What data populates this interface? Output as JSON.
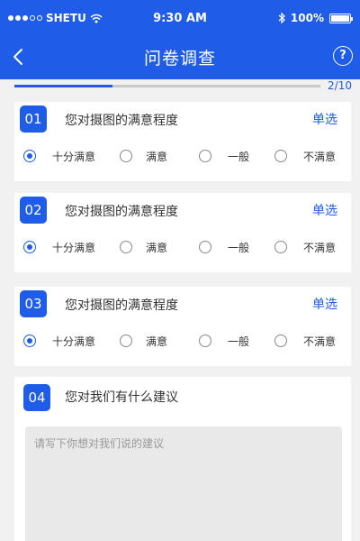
{
  "status_bar": {
    "carrier": "SHETU",
    "time": "9:30 AM",
    "battery": "100%",
    "signal_icon": "signal-dots-icon",
    "wifi_icon": "wifi-icon",
    "bluetooth_icon": "bluetooth-icon",
    "battery_icon": "battery-icon",
    "battery_level": 1.0
  },
  "nav": {
    "title": "问卷调查",
    "back_icon": "chevron-left-icon",
    "help_icon": "question-circle-icon",
    "help_glyph": "?"
  },
  "progress": {
    "label": "2/10",
    "fraction": 0.32
  },
  "questions": [
    {
      "number": "01",
      "title": "您对摄图的满意程度",
      "type": "单选",
      "options": [
        "十分满意",
        "满意",
        "一般",
        "不满意"
      ],
      "selected": 0
    },
    {
      "number": "02",
      "title": "您对摄图的满意程度",
      "type": "单选",
      "options": [
        "十分满意",
        "满意",
        "一般",
        "不满意"
      ],
      "selected": 0
    },
    {
      "number": "03",
      "title": "您对摄图的满意程度",
      "type": "单选",
      "options": [
        "十分满意",
        "满意",
        "一般",
        "不满意"
      ],
      "selected": 0
    },
    {
      "number": "04",
      "title": "您对我们有什么建议",
      "placeholder": "请写下你想对我们说的建议",
      "value": ""
    }
  ],
  "colors": {
    "primary": "#1f5ce8",
    "background": "#f1f1f1",
    "input_bg": "#e9e9e9"
  }
}
